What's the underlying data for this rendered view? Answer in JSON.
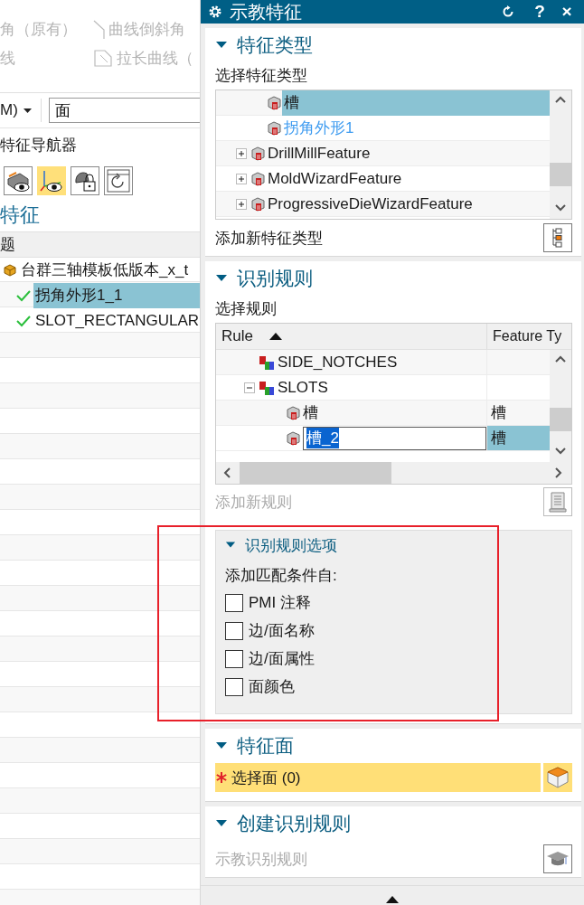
{
  "left": {
    "ribbon": [
      [
        {
          "label": "角（原有）",
          "disabled": true,
          "kind": "plain"
        },
        {
          "label": "曲线倒斜角",
          "disabled": true,
          "kind": "chamfer"
        }
      ],
      [
        {
          "label": "线",
          "disabled": true,
          "kind": "plain"
        },
        {
          "label": "拉长曲线（",
          "disabled": true,
          "kind": "extend"
        }
      ]
    ],
    "filter": {
      "menu": "M)",
      "value": "面"
    },
    "navigator_title": "特征导航器",
    "tool_buttons": [
      {
        "kind": "show-body",
        "selected": false
      },
      {
        "kind": "show-axes",
        "selected": true
      },
      {
        "kind": "lock",
        "selected": false
      },
      {
        "kind": "refresh",
        "selected": false
      }
    ],
    "heading": "特征",
    "tree": {
      "column": "题",
      "nodes": [
        {
          "label": "台群三轴模板低版本_x_t",
          "kind": "part",
          "children": [
            {
              "label": "拐角外形1_1",
              "kind": "feature",
              "checked": true,
              "selected": true
            },
            {
              "label": "SLOT_RECTANGULAR",
              "kind": "feature",
              "checked": true,
              "selected": false
            }
          ]
        }
      ]
    }
  },
  "dialog": {
    "title": "示教特征",
    "buttons": [
      {
        "kind": "reset"
      },
      {
        "kind": "help",
        "label": "?"
      },
      {
        "kind": "close",
        "label": "×"
      }
    ],
    "sections": [
      {
        "kind": "feature-types",
        "title": "特征类型",
        "expanded": true,
        "label": "选择特征类型",
        "add_label": "添加新特征类型",
        "tree": [
          {
            "children": [
              {
                "label": "槽",
                "selected": true,
                "highlighted": false
              },
              {
                "label": "拐角外形1",
                "selected": false,
                "highlighted": true
              }
            ]
          },
          {
            "label": "DrillMillFeature",
            "expanded": false,
            "selected": false,
            "highlighted": false
          },
          {
            "label": "MoldWizardFeature",
            "expanded": false,
            "selected": false,
            "highlighted": false
          },
          {
            "label": "ProgressiveDieWizardFeature",
            "expanded": false,
            "selected": false,
            "highlighted": false
          }
        ]
      },
      {
        "kind": "rules",
        "title": "识别规则",
        "expanded": true,
        "label": "选择规则",
        "columns": [
          {
            "label": "Rule",
            "sorted": true
          },
          {
            "label": "Feature Ty",
            "sorted": false
          }
        ],
        "rows": [
          {
            "rule": "SIDE_NOTCHES",
            "kind": "group"
          },
          {
            "rule": "SLOTS",
            "kind": "group",
            "expanded": true,
            "children": [
              {
                "rule": "槽",
                "feature_type": "槽",
                "kind": "feature",
                "selected": false,
                "editing": false
              },
              {
                "rule": "槽_2",
                "feature_type": "槽",
                "kind": "feature",
                "selected": true,
                "editing": true
              }
            ]
          }
        ],
        "add_label": "添加新规则",
        "add_disabled": true,
        "options": {
          "title": "识别规则选项",
          "expanded": true,
          "label": "添加匹配条件自:",
          "checkboxes": [
            {
              "label": "PMI 注释",
              "checked": false
            },
            {
              "label": "边/面名称",
              "checked": false
            },
            {
              "label": "边/面属性",
              "checked": false
            },
            {
              "label": "面颜色",
              "checked": false
            }
          ]
        }
      },
      {
        "kind": "faces",
        "title": "特征面",
        "expanded": true,
        "select": {
          "label": "选择面 (0)",
          "required": true
        }
      },
      {
        "kind": "create",
        "title": "创建识别规则",
        "expanded": true,
        "action": {
          "label": "示教识别规则",
          "disabled": true
        }
      }
    ]
  }
}
